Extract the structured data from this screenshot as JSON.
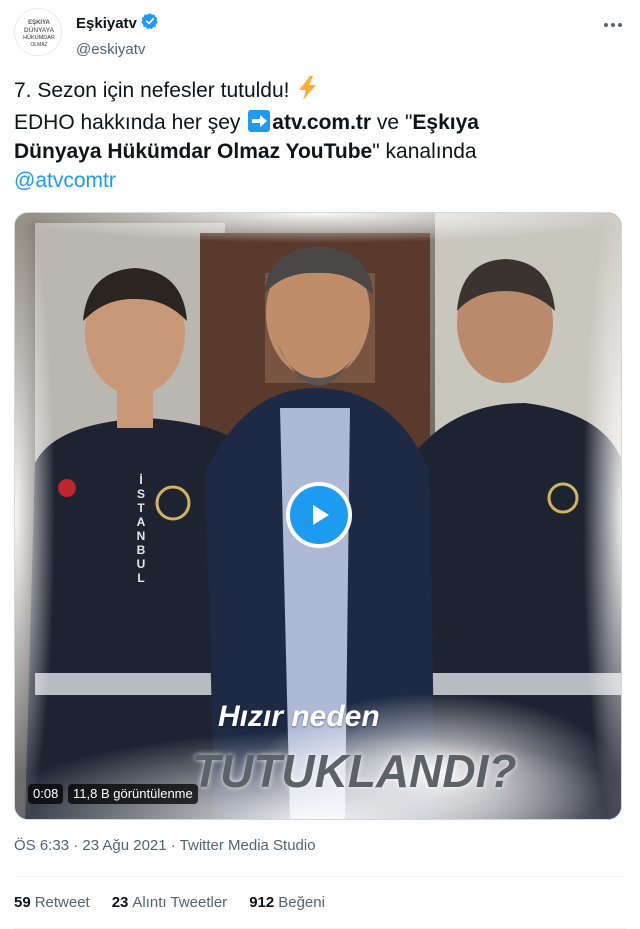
{
  "header": {
    "avatar_text": [
      "EŞKIYA",
      "DÜNYAYA",
      "HÜKÜMDAR",
      "OLMAZ"
    ],
    "display_name": "Eşkiyatv",
    "handle": "@eskiyatv",
    "verified_icon": "verified-badge-icon",
    "more_icon": "more-horizontal-icon"
  },
  "tweet": {
    "line1": "7. Sezon için nefesler tutuldu!",
    "line2_prefix": "EDHO hakkında her şey",
    "link": "atv.com.tr",
    "line2_mid": " ve \"",
    "bold_part1": "Eşkıya",
    "bold_part2": "Dünyaya Hükümdar Olmaz YouTube",
    "line3_suffix": "\" kanalında",
    "mention": "@atvcomtr",
    "emoji_bolt": "high-voltage-icon",
    "emoji_arrow": "right-arrow-icon"
  },
  "media": {
    "caption_line1": "Hızır neden",
    "caption_line2": "TUTUKLANDI?",
    "duration": "0:08",
    "views": "11,8 B görüntülenme",
    "patch_text": [
      "İ",
      "S",
      "T",
      "A",
      "N",
      "B",
      "U",
      "L"
    ]
  },
  "meta": {
    "timestamp": "ÖS 6:33 · 23 Ağu 2021 · Twitter Media Studio"
  },
  "stats": {
    "retweets_count": "59",
    "retweets_label": "Retweet",
    "quotes_count": "23",
    "quotes_label": "Alıntı Tweetler",
    "likes_count": "912",
    "likes_label": "Beğeni"
  },
  "colors": {
    "accent": "#1d9bf0",
    "text": "#0f1419",
    "muted": "#536471"
  }
}
